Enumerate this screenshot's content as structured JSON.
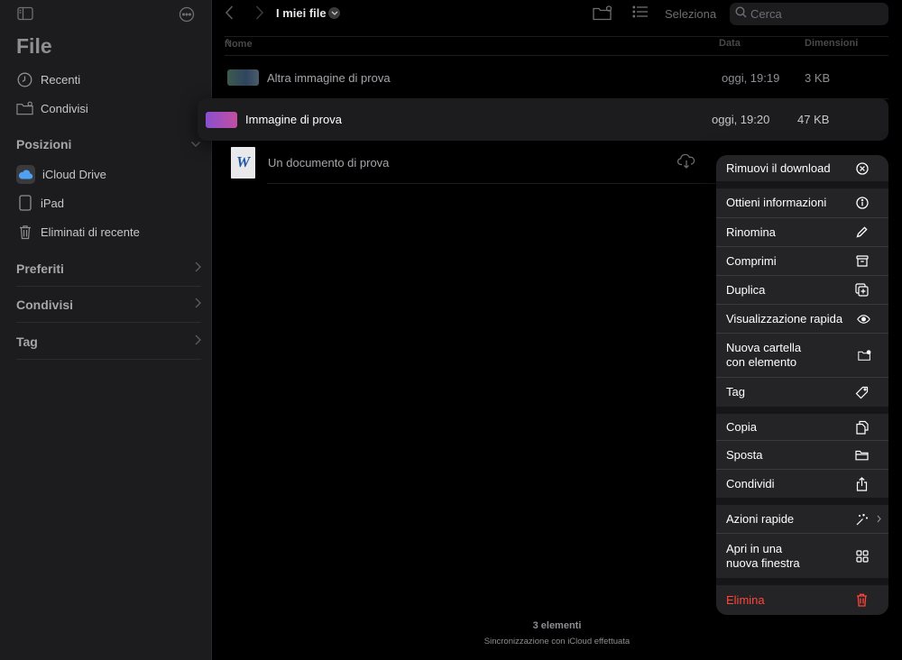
{
  "sidebar": {
    "title": "File",
    "items": [
      {
        "label": "Recenti",
        "icon": "clock-icon"
      },
      {
        "label": "Condivisi",
        "icon": "shared-folder-icon"
      }
    ],
    "positions_header": "Posizioni",
    "locations": [
      {
        "label": "iCloud Drive",
        "icon": "icloud-icon"
      },
      {
        "label": "iPad",
        "icon": "ipad-icon"
      },
      {
        "label": "Eliminati di recente",
        "icon": "trash-icon"
      }
    ],
    "sections": [
      "Preferiti",
      "Condivisi",
      "Tag"
    ]
  },
  "toolbar": {
    "title": "I miei file",
    "select_label": "Seleziona",
    "search_placeholder": "Cerca"
  },
  "columns": {
    "name": "Nome",
    "sort_indicator": "^",
    "date": "Data",
    "size": "Dimensioni"
  },
  "files": [
    {
      "name": "Altra immagine di prova",
      "date": "oggi, 19:19",
      "size": "3 KB"
    },
    {
      "name": "Immagine di prova",
      "date": "oggi, 19:20",
      "size": "47 KB"
    },
    {
      "name": "Un documento di prova",
      "thumb_letter": "W"
    }
  ],
  "menu": {
    "items": [
      {
        "label": "Rimuovi il download",
        "icon": "x-circle-icon"
      },
      {
        "label": "Ottieni informazioni",
        "icon": "info-icon"
      },
      {
        "label": "Rinomina",
        "icon": "pencil-icon"
      },
      {
        "label": "Comprimi",
        "icon": "archive-icon"
      },
      {
        "label": "Duplica",
        "icon": "duplicate-icon"
      },
      {
        "label": "Visualizzazione rapida",
        "icon": "eye-icon"
      },
      {
        "label": "Nuova cartella\ncon elemento",
        "icon": "folder-badge-icon"
      },
      {
        "label": "Tag",
        "icon": "tag-icon"
      },
      {
        "label": "Copia",
        "icon": "copy-icon"
      },
      {
        "label": "Sposta",
        "icon": "folder-icon"
      },
      {
        "label": "Condividi",
        "icon": "share-icon"
      },
      {
        "label": "Azioni rapide",
        "icon": "sparkles-icon"
      },
      {
        "label": "Apri in una\nnuova finestra",
        "icon": "grid-icon"
      },
      {
        "label": "Elimina",
        "icon": "trash-icon"
      }
    ]
  },
  "footer": {
    "count": "3 elementi",
    "sync": "Sincronizzazione con iCloud effettuata"
  },
  "colors": {
    "danger": "#ff453a",
    "background": "#000000",
    "sidebar": "#1c1c1e",
    "menu": "#242426"
  }
}
